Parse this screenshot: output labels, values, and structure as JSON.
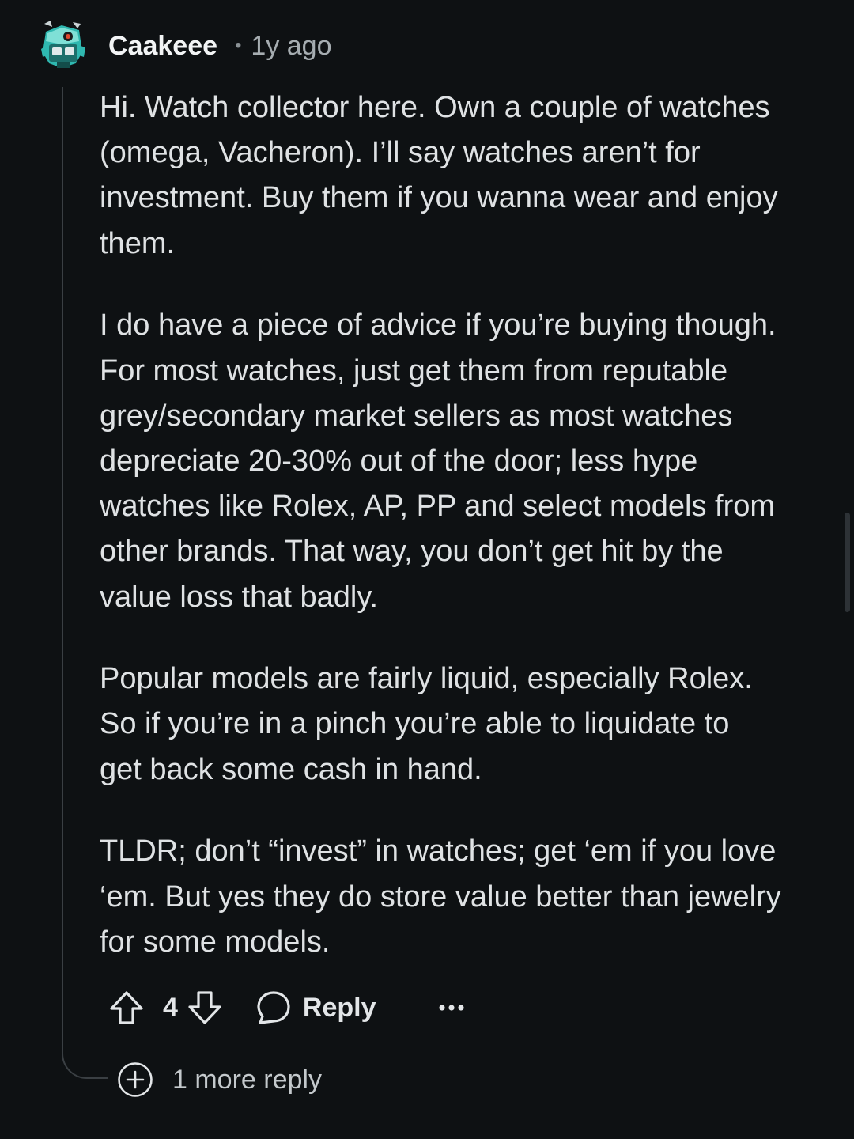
{
  "comment": {
    "username": "Caakeee",
    "separator": "•",
    "timestamp": "1y ago",
    "avatar_icon": "robot-avatar-icon",
    "paragraphs": [
      "Hi. Watch collector here. Own a couple of watches\n(omega, Vacheron). I’ll say watches aren’t for\ninvestment. Buy them if you wanna wear and enjoy\nthem.",
      "I do have a piece of advice if you’re buying though.\nFor most watches, just get them from reputable\ngrey/secondary market sellers as most watches\ndepreciate 20-30% out of the door; less hype\nwatches like Rolex, AP, PP and select models from\nother brands. That way, you don’t get hit by the\nvalue loss that badly.",
      "Popular models are fairly liquid, especially Rolex.\nSo if you’re in a pinch you’re able to liquidate to\nget back some cash in hand.",
      "TLDR; don’t “invest” in watches; get ‘em if you love\n‘em. But yes they do store value better than jewelry\nfor some models."
    ]
  },
  "actions": {
    "upvote_icon": "upvote-arrow-icon",
    "vote_count": "4",
    "downvote_icon": "downvote-arrow-icon",
    "reply_icon": "speech-bubble-icon",
    "reply_label": "Reply",
    "more_icon": "ellipsis-icon"
  },
  "more_replies": {
    "icon": "plus-circle-icon",
    "label": "1 more reply"
  },
  "colors": {
    "background": "#0e1113",
    "text": "#dfe2e4",
    "muted": "#a6adb1",
    "thread_line": "#3a3f43",
    "avatar_accent": "#2fb8b0"
  }
}
